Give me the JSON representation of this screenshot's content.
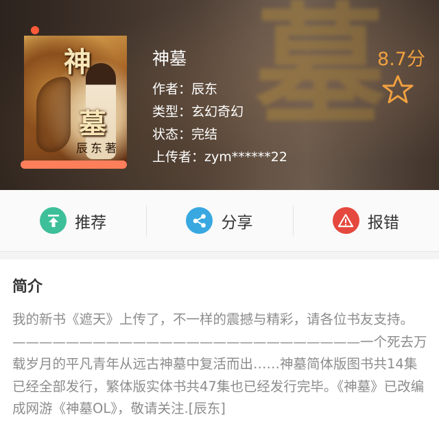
{
  "book": {
    "title": "神墓",
    "author_line": "作者：辰东",
    "type_line": "类型：玄幻奇幻",
    "status_line": "状态：完结",
    "uploader_line": "上传者：zym******22",
    "score": "8.7分",
    "cover": {
      "title_char_1": "神",
      "title_char_2": "墓",
      "author_text": "辰东著"
    },
    "background_glyph": "墓"
  },
  "actions": [
    {
      "label": "推荐",
      "icon": "upload-arrow-icon",
      "color": "#3dbf9a"
    },
    {
      "label": "分享",
      "icon": "share-icon",
      "color": "#39a8e0"
    },
    {
      "label": "报错",
      "icon": "warning-icon",
      "color": "#e5483e"
    }
  ],
  "intro": {
    "heading": "简介",
    "text": "我的新书《遮天》上传了，不一样的震撼与精彩，请各位书友支持。——————————————————————————一个死去万载岁月的平凡青年从远古神墓中复活而出……神墓简体版图书共14集已经全部发行，繁体版实体书共47集也已经发行完毕。《神墓》已改编成网游《神墓OL》，敬请关注.[辰东]"
  },
  "colors": {
    "score": "#f0a040",
    "accent_star": "#f0a040",
    "intro_text": "#8c8c8c"
  }
}
